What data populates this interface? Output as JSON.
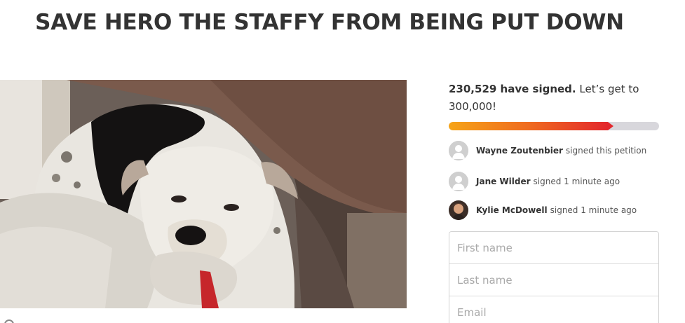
{
  "petition": {
    "title": "SAVE HERO THE STAFFY FROM BEING PUT DOWN",
    "image_alt": "Hero the staffy lying on a couch"
  },
  "signatures": {
    "count_bold": "230,529 have signed.",
    "count_rest": " Let’s get to 300,000!",
    "signed": 230529,
    "goal": 300000,
    "progress_fraction": 0.7684
  },
  "recent_signers": [
    {
      "name": "Wayne Zoutenbier",
      "action": "signed this petition",
      "avatar": "default-person-icon"
    },
    {
      "name": "Jane Wilder",
      "action": "signed 1 minute ago",
      "avatar": "default-person-icon"
    },
    {
      "name": "Kylie McDowell",
      "action": "signed 1 minute ago",
      "avatar": "user-photo"
    }
  ],
  "form": {
    "first_name_placeholder": "First name",
    "last_name_placeholder": "Last name",
    "email_placeholder": "Email"
  },
  "colors": {
    "progress_start": "#f6a418",
    "progress_end": "#e3272c",
    "progress_track": "#d8d7dc"
  }
}
